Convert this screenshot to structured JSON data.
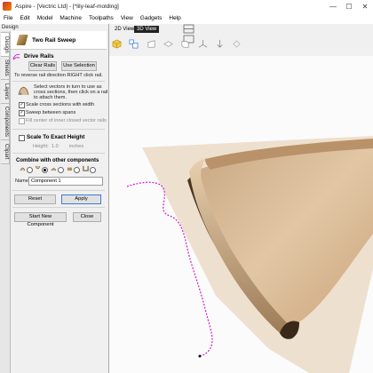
{
  "window": {
    "title": "Aspire - [Vectric Ltd] - [*lily-leaf-molding]",
    "controls": [
      "—",
      "☐",
      "✕"
    ]
  },
  "menu": [
    "File",
    "Edit",
    "Model",
    "Machine",
    "Toolpaths",
    "View",
    "Gadgets",
    "Help"
  ],
  "left_panel": {
    "pane_title": "Design",
    "vertical_tabs": [
      "Design",
      "Sheets",
      "Layers",
      "Components",
      "Clipart"
    ],
    "tool_title": "Two Rail Sweep",
    "drive_rails": {
      "heading": "Drive Rails",
      "clear_label": "Clear Rails",
      "use_selection_label": "Use Selection",
      "reverse_hint": "To reverse rail direction RIGHT click rail."
    },
    "cross_sections": {
      "hint_line1": "Select vectors in turn to use as",
      "hint_line2": "cross sections, then click on a rail",
      "hint_line3": "to attach them.",
      "scale_label": "Scale cross sections with width",
      "sweep_label": "Sweep between spans",
      "fill_label": "Fill center of inner closed vector rails"
    },
    "scale_height": {
      "label": "Scale To Exact Height",
      "height_label": "Height:",
      "height_value": "1.0",
      "units": "inches"
    },
    "combine": {
      "heading": "Combine with other components",
      "selected_index": 1,
      "name_label": "Name",
      "name_value": "Component 1"
    },
    "reset_label": "Reset",
    "apply_label": "Apply",
    "start_new_label": "Start New Component",
    "close_label": "Close"
  },
  "view": {
    "tab_2d": "2D View",
    "tab_3d": "3D View",
    "active_tab": "3D View"
  },
  "colors": {
    "rail": "#d01ed0",
    "wood_light": "#d8bb98",
    "wood_dark": "#4a3522",
    "plane": "#eee0cf"
  }
}
